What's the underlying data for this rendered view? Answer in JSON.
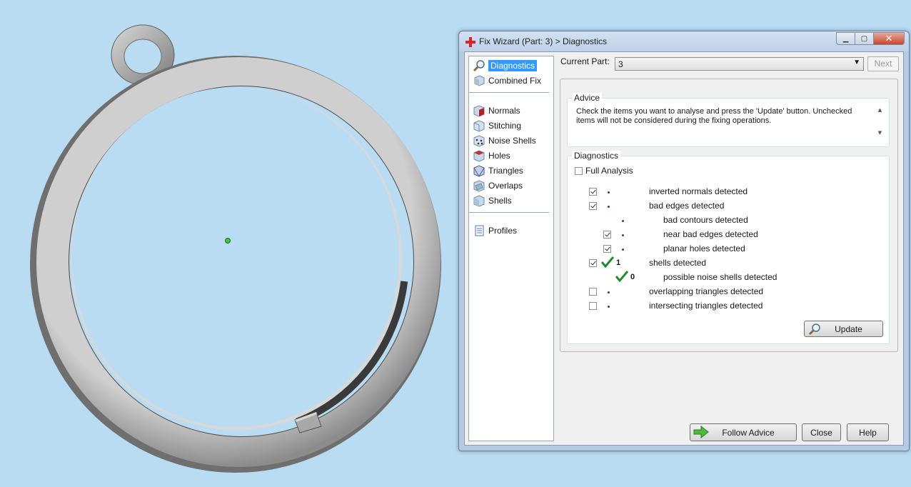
{
  "window": {
    "title": "Fix Wizard (Part: 3) > Diagnostics"
  },
  "nav": {
    "items": [
      {
        "label": "Diagnostics",
        "icon": "magnifier-icon",
        "selected": true
      },
      {
        "label": "Combined Fix",
        "icon": "cube-icon"
      },
      {
        "label": "Normals",
        "icon": "normals-cube-icon"
      },
      {
        "label": "Stitching",
        "icon": "stitching-cube-icon"
      },
      {
        "label": "Noise Shells",
        "icon": "noise-shells-icon"
      },
      {
        "label": "Holes",
        "icon": "holes-cube-icon"
      },
      {
        "label": "Triangles",
        "icon": "triangles-cube-icon"
      },
      {
        "label": "Overlaps",
        "icon": "overlaps-cube-icon"
      },
      {
        "label": "Shells",
        "icon": "shells-cube-icon"
      },
      {
        "label": "Profiles",
        "icon": "document-icon"
      }
    ]
  },
  "current_part": {
    "label": "Current Part:",
    "value": "3",
    "next_label": "Next"
  },
  "advice": {
    "title": "Advice",
    "text": "Check the items you want to analyse and press the 'Update' button. Unchecked items will not be considered during the fixing operations."
  },
  "diagnostics": {
    "title": "Diagnostics",
    "full_analysis": {
      "label": "Full Analysis",
      "checked": false
    },
    "rows": [
      {
        "label": "inverted normals detected",
        "checked": true
      },
      {
        "label": "bad edges detected",
        "checked": true
      },
      {
        "label": "bad contours detected"
      },
      {
        "label": "near bad edges detected",
        "checked": true
      },
      {
        "label": "planar holes detected",
        "checked": true
      },
      {
        "label": "shells detected",
        "checked": true,
        "count": "1"
      },
      {
        "label": "possible noise shells detected",
        "count": "0"
      },
      {
        "label": "overlapping triangles detected",
        "checked": false
      },
      {
        "label": "intersecting triangles detected",
        "checked": false
      }
    ],
    "update_label": "Update"
  },
  "footer": {
    "follow_advice_label": "Follow Advice",
    "close_label": "Close",
    "help_label": "Help"
  },
  "colors": {
    "background": "#b9dcf3",
    "selection": "#3399ff",
    "check_green": "#1f8a2e"
  }
}
